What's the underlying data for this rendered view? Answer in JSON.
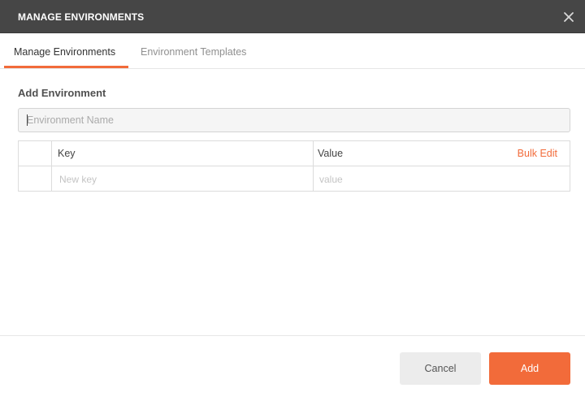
{
  "modal": {
    "title": "MANAGE ENVIRONMENTS",
    "close_icon": "close-icon"
  },
  "tabs": [
    {
      "label": "Manage Environments",
      "active": true
    },
    {
      "label": "Environment Templates",
      "active": false
    }
  ],
  "add_environment": {
    "section_title": "Add Environment",
    "name_input": {
      "value": "",
      "placeholder": "Environment Name"
    }
  },
  "variables_table": {
    "headers": {
      "key": "Key",
      "value": "Value",
      "bulk_edit": "Bulk Edit"
    },
    "new_row": {
      "key_placeholder": "New key",
      "value_placeholder": "value"
    }
  },
  "footer": {
    "cancel_label": "Cancel",
    "add_label": "Add"
  },
  "colors": {
    "accent": "#f26b3a",
    "titlebar": "#464646"
  }
}
